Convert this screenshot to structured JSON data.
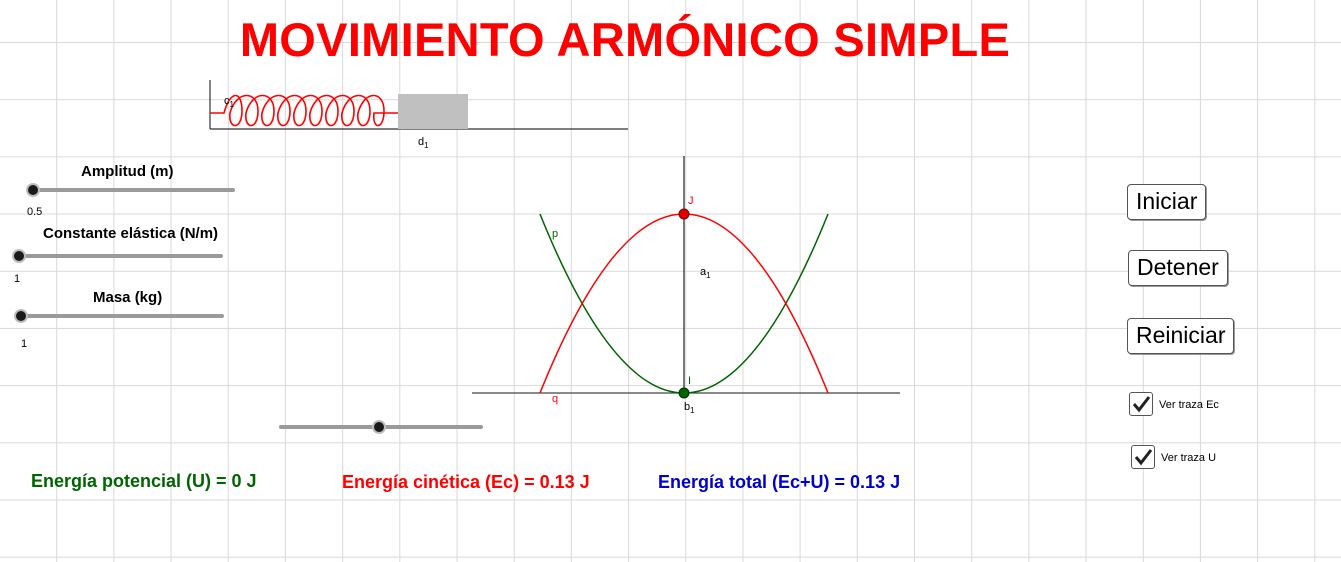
{
  "title": "MOVIMIENTO ARMÓNICO SIMPLE",
  "sliders": [
    {
      "label": "Amplitud (m)",
      "value": "0.5"
    },
    {
      "label": "Constante elástica (N/m)",
      "value": "1"
    },
    {
      "label": "Masa (kg)",
      "value": "1"
    }
  ],
  "energies": {
    "potential": "Energía potencial (U) = 0 J",
    "kinetic": "Energía cinética (Ec) = 0.13 J",
    "total": "Energía total (Ec+U) = 0.13 J"
  },
  "buttons": {
    "start": "Iniciar",
    "stop": "Detener",
    "reset": "Reiniciar"
  },
  "checkboxes": [
    {
      "label": "Ver traza Ec",
      "checked": true
    },
    {
      "label": "Ver traza U",
      "checked": true
    }
  ],
  "spring_labels": {
    "spring": "c",
    "spring_sub": "1",
    "distance": "d",
    "distance_sub": "1"
  },
  "graph_labels": {
    "J": "J",
    "I": "I",
    "p": "p",
    "q": "q",
    "a": "a",
    "a_sub": "1",
    "b": "b",
    "b_sub": "1"
  },
  "colors": {
    "title": "#ff0000",
    "potential": "#006400",
    "kinetic": "#ff0000",
    "total": "#0000cc",
    "spring": "#ff0000",
    "mass": "#c0c0c0"
  },
  "icons": {
    "checkbox": "check-icon"
  }
}
